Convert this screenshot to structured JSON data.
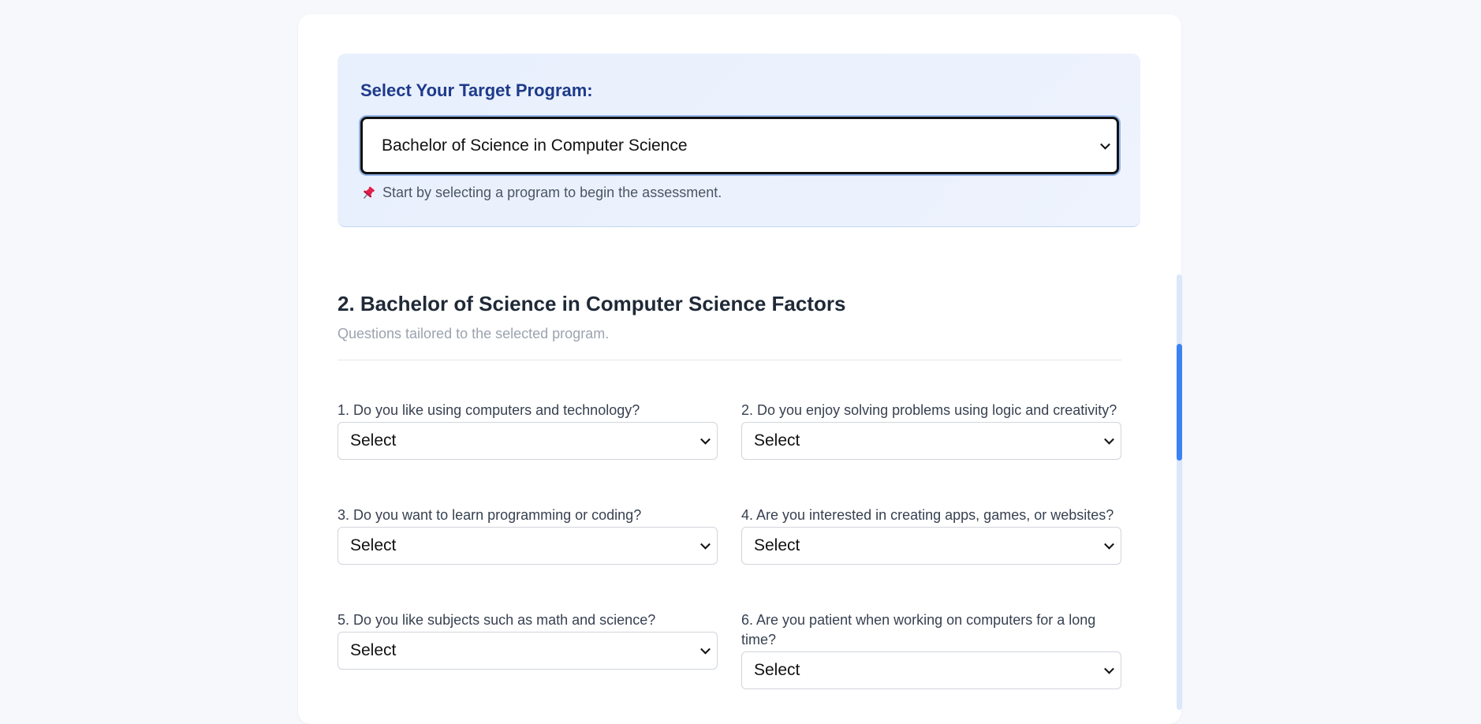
{
  "program_selector": {
    "title": "Select Your Target Program:",
    "selected": "Bachelor of Science in Computer Science",
    "hint": "Start by selecting a program to begin the assessment.",
    "hint_icon": "pushpin-icon"
  },
  "section": {
    "title": "2. Bachelor of Science in Computer Science Factors",
    "subtitle": "Questions tailored to the selected program.",
    "questions": [
      {
        "label": "1. Do you like using computers and technology?",
        "value": "Select"
      },
      {
        "label": "2. Do you enjoy solving problems using logic and creativity?",
        "value": "Select"
      },
      {
        "label": "3. Do you want to learn programming or coding?",
        "value": "Select"
      },
      {
        "label": "4. Are you interested in creating apps, games, or websites?",
        "value": "Select"
      },
      {
        "label": "5. Do you like subjects such as math and science?",
        "value": "Select"
      },
      {
        "label": "6. Are you patient when working on computers for a long time?",
        "value": "Select"
      }
    ]
  },
  "colors": {
    "page_bg": "#f6f8fb",
    "panel_bg": "#e8f0fd",
    "panel_title": "#1e3a8a",
    "accent": "#3b82f6",
    "pin": "#e11d48"
  }
}
